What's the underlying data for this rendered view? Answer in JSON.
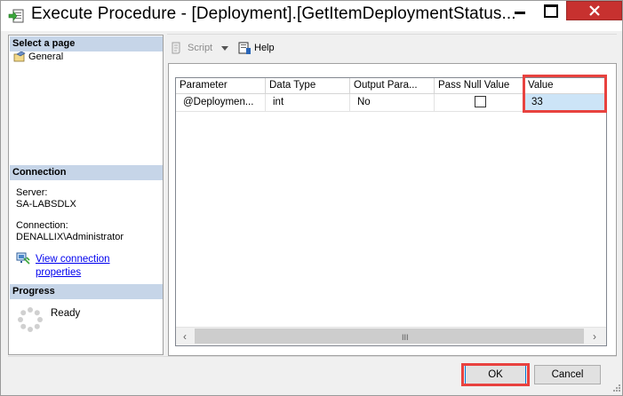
{
  "window": {
    "title": "Execute Procedure - [Deployment].[GetItemDeploymentStatus..."
  },
  "left_pane": {
    "select_page_header": "Select a page",
    "pages": [
      {
        "label": "General",
        "icon": "general-page-icon"
      }
    ],
    "connection_header": "Connection",
    "server_label": "Server:",
    "server_value": "SA-LABSDLX",
    "connection_label": "Connection:",
    "connection_value": "DENALLIX\\Administrator",
    "view_connection_line1": "View connection",
    "view_connection_line2": "properties",
    "progress_header": "Progress",
    "progress_status": "Ready"
  },
  "toolbar": {
    "script_label": "Script",
    "help_label": "Help"
  },
  "grid": {
    "columns": [
      "Parameter",
      "Data Type",
      "Output Para...",
      "Pass Null Value",
      "Value"
    ],
    "rows": [
      {
        "parameter": "@Deploymen...",
        "data_type": "int",
        "output_param": "No",
        "pass_null": false,
        "value": "33"
      }
    ]
  },
  "scrollbar": {
    "grip": "III"
  },
  "buttons": {
    "ok": "OK",
    "cancel": "Cancel"
  },
  "colors": {
    "highlight": "#e8423f",
    "section_header": "#c6d5e8",
    "selected_cell": "#cce4f7",
    "close_button": "#c7312f"
  }
}
